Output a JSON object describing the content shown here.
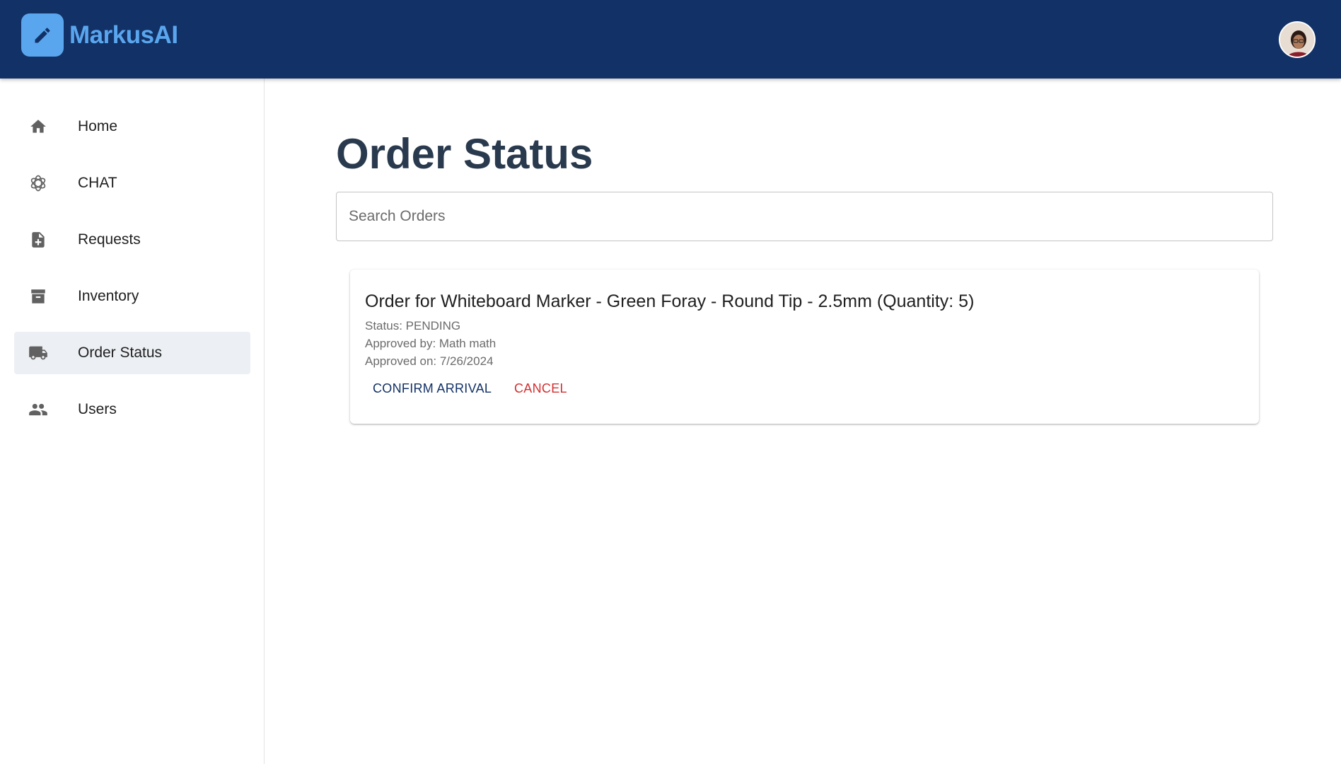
{
  "app": {
    "name": "MarkusAI"
  },
  "sidebar": {
    "items": [
      {
        "label": "Home",
        "icon": "home-icon"
      },
      {
        "label": "CHAT",
        "icon": "openai-swirl-icon"
      },
      {
        "label": "Requests",
        "icon": "file-plus-icon"
      },
      {
        "label": "Inventory",
        "icon": "archive-box-icon"
      },
      {
        "label": "Order Status",
        "icon": "truck-icon",
        "active": true
      },
      {
        "label": "Users",
        "icon": "users-icon"
      }
    ]
  },
  "main": {
    "title": "Order Status",
    "search": {
      "placeholder": "Search Orders",
      "value": ""
    },
    "orders": [
      {
        "title": "Order for Whiteboard Marker - Green Foray - Round Tip - 2.5mm (Quantity: 5)",
        "status": "Status: PENDING",
        "approved_by": "Approved by: Math math",
        "approved_on": "Approved on: 7/26/2024",
        "confirm_label": "CONFIRM ARRIVAL",
        "cancel_label": "CANCEL"
      }
    ]
  },
  "colors": {
    "appbar": "#123166",
    "brand": "#5aa6ee",
    "title": "#2a3a4e",
    "cancel": "#d32f2f",
    "active_nav": "#eceff3"
  }
}
